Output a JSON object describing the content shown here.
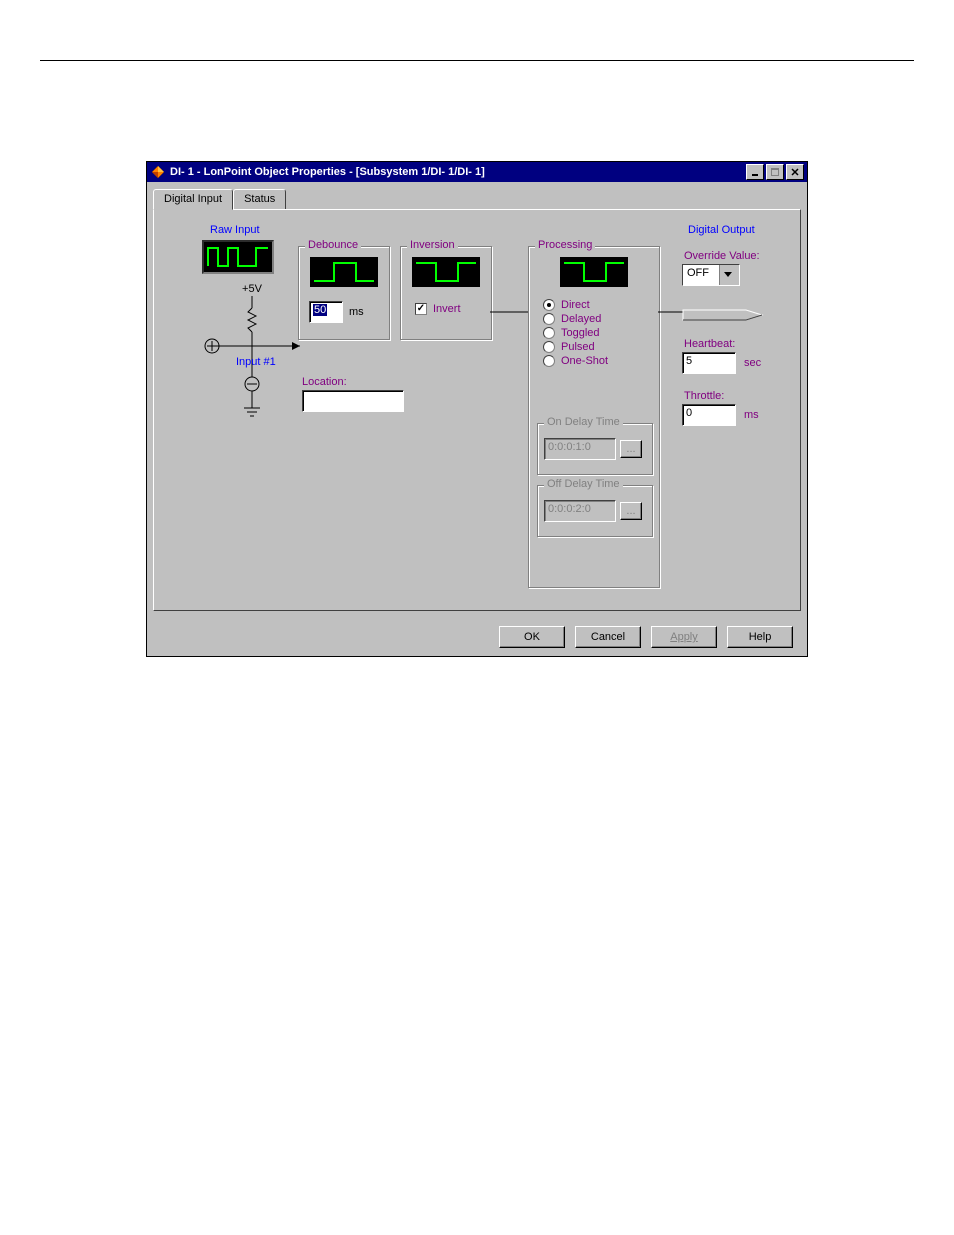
{
  "window": {
    "title": "DI- 1 - LonPoint Object Properties - [Subsystem 1/DI- 1/DI- 1]"
  },
  "tabs": {
    "t0": "Digital Input",
    "t1": "Status"
  },
  "raw_input": {
    "heading": "Raw Input",
    "voltage": "+5V",
    "input_label": "Input #1"
  },
  "debounce": {
    "title": "Debounce",
    "value": "50",
    "unit": "ms"
  },
  "inversion": {
    "title": "Inversion",
    "checkbox_label": "Invert",
    "checked": true
  },
  "location": {
    "label": "Location:",
    "value": ""
  },
  "processing": {
    "title": "Processing",
    "options": {
      "direct": "Direct",
      "delayed": "Delayed",
      "toggled": "Toggled",
      "pulsed": "Pulsed",
      "oneshot": "One-Shot"
    },
    "selected": "direct",
    "on_delay": {
      "title": "On Delay Time",
      "value": "0:0:0:1:0",
      "ellipsis": "..."
    },
    "off_delay": {
      "title": "Off Delay Time",
      "value": "0:0:0:2:0",
      "ellipsis": "..."
    }
  },
  "digital_output": {
    "heading": "Digital Output",
    "override_label": "Override Value:",
    "override_value": "OFF",
    "heartbeat_label": "Heartbeat:",
    "heartbeat_value": "5",
    "heartbeat_unit": "sec",
    "throttle_label": "Throttle:",
    "throttle_value": "0",
    "throttle_unit": "ms"
  },
  "buttons": {
    "ok": "OK",
    "cancel": "Cancel",
    "apply": "Apply",
    "help": "Help"
  }
}
